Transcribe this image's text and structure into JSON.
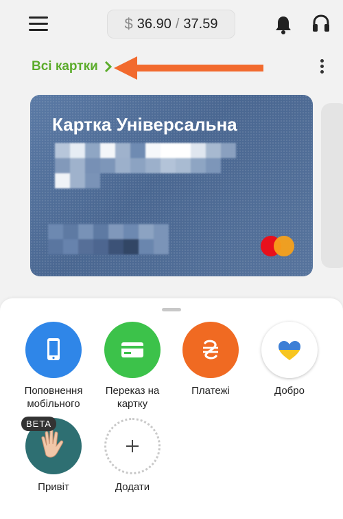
{
  "header": {
    "balance_current": "36.90",
    "balance_separator": "/",
    "balance_limit": "37.59",
    "currency_symbol": "$"
  },
  "cards_link": {
    "label": "Всі картки"
  },
  "card": {
    "title": "Картка Універсальна"
  },
  "actions": [
    {
      "label": "Поповнення мобільного",
      "icon": "phone-icon",
      "color": "#2f86e8"
    },
    {
      "label": "Переказ на картку",
      "icon": "card-icon",
      "color": "#3cc24a"
    },
    {
      "label": "Платежі",
      "icon": "hryvnia-icon",
      "color": "#f06a22"
    },
    {
      "label": "Добро",
      "icon": "heart-icon",
      "color": "#ffffff"
    },
    {
      "label": "Привіт",
      "icon": "hand-wave-icon",
      "color": "#2e6f72",
      "badge": "BETA"
    },
    {
      "label": "Додати",
      "icon": "plus-icon",
      "color": "#ffffff"
    }
  ],
  "colors": {
    "accent_green": "#5cac2c",
    "annotation_arrow": "#f26a2e",
    "card_blue": "#4f6d97"
  }
}
